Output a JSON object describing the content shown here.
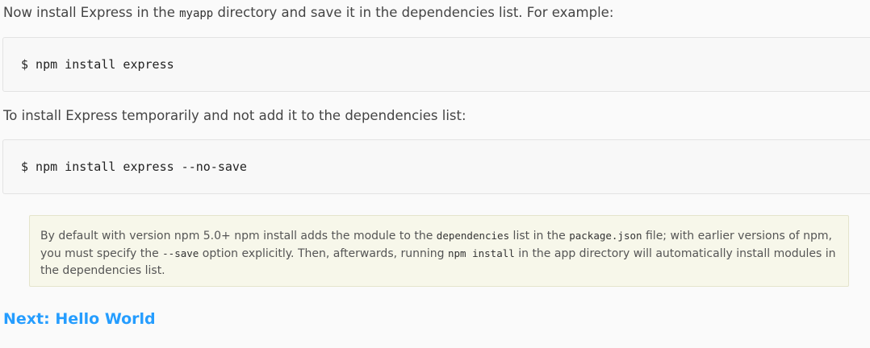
{
  "intro": {
    "text_before": "Now install Express in the ",
    "code": "myapp",
    "text_after": " directory and save it in the dependencies list. For example:"
  },
  "code_block_1": {
    "command": "$ npm install express"
  },
  "temp_install": {
    "text": "To install Express temporarily and not add it to the dependencies list:"
  },
  "code_block_2": {
    "command": "$ npm install express --no-save"
  },
  "note": {
    "part1": "By default with version npm 5.0+ npm install adds the module to the ",
    "code1": "dependencies",
    "part2": " list in the ",
    "code2": "package.json",
    "part3": " file; with earlier versions of npm, you must specify the ",
    "code3": "--save",
    "part4": " option explicitly. Then, afterwards, running ",
    "code4": "npm install",
    "part5": " in the app directory will automatically install modules in the dependencies list."
  },
  "next_link": {
    "label": "Next: Hello World"
  },
  "colors": {
    "link": "#259dff",
    "note_background": "#f7f7ea",
    "code_background": "#f8f8f8"
  }
}
